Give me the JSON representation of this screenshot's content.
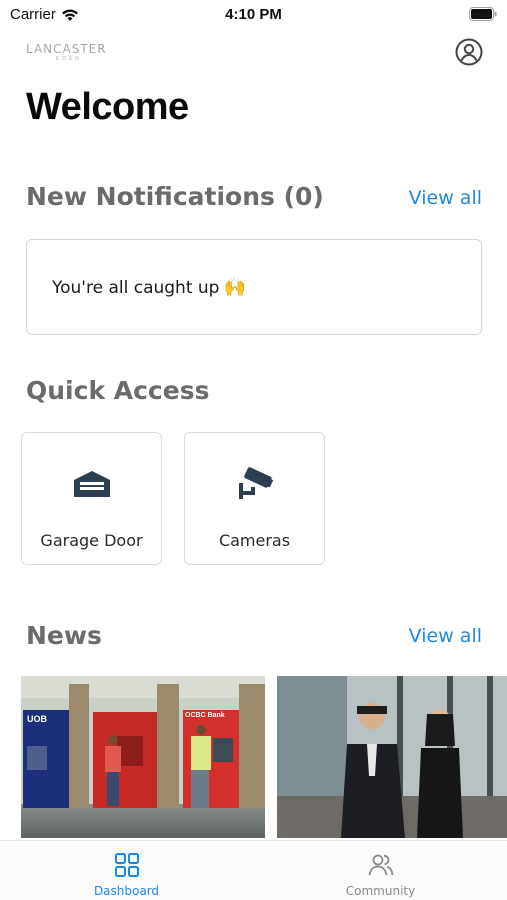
{
  "status_bar": {
    "carrier": "Carrier",
    "time": "4:10 PM"
  },
  "header": {
    "logo_main": "LANCASTER",
    "logo_sub": "EDEN",
    "profile_icon": "user-circle-icon"
  },
  "page": {
    "title": "Welcome"
  },
  "notifications": {
    "title": "New Notifications (0)",
    "view_all": "View all",
    "empty_message": "You're all caught up",
    "empty_emoji": "🙌"
  },
  "quick_access": {
    "title": "Quick Access",
    "items": [
      {
        "label": "Garage Door",
        "icon": "garage-icon"
      },
      {
        "label": "Cameras",
        "icon": "cctv-camera-icon"
      }
    ]
  },
  "news": {
    "title": "News",
    "view_all": "View all",
    "items": [
      {
        "image": "atm-branch-photo",
        "bank_signs": [
          "UOB",
          "OCBC Bank"
        ]
      },
      {
        "image": "business-people-photo"
      }
    ]
  },
  "tab_bar": {
    "tabs": [
      {
        "label": "Dashboard",
        "icon": "grid-icon",
        "active": true
      },
      {
        "label": "Community",
        "icon": "people-icon",
        "active": false
      }
    ]
  },
  "colors": {
    "accent": "#1e88e5",
    "section_title": "#6b6b6b",
    "icon_dark": "#2c3e50",
    "tab_inactive": "#8a8a8a"
  }
}
